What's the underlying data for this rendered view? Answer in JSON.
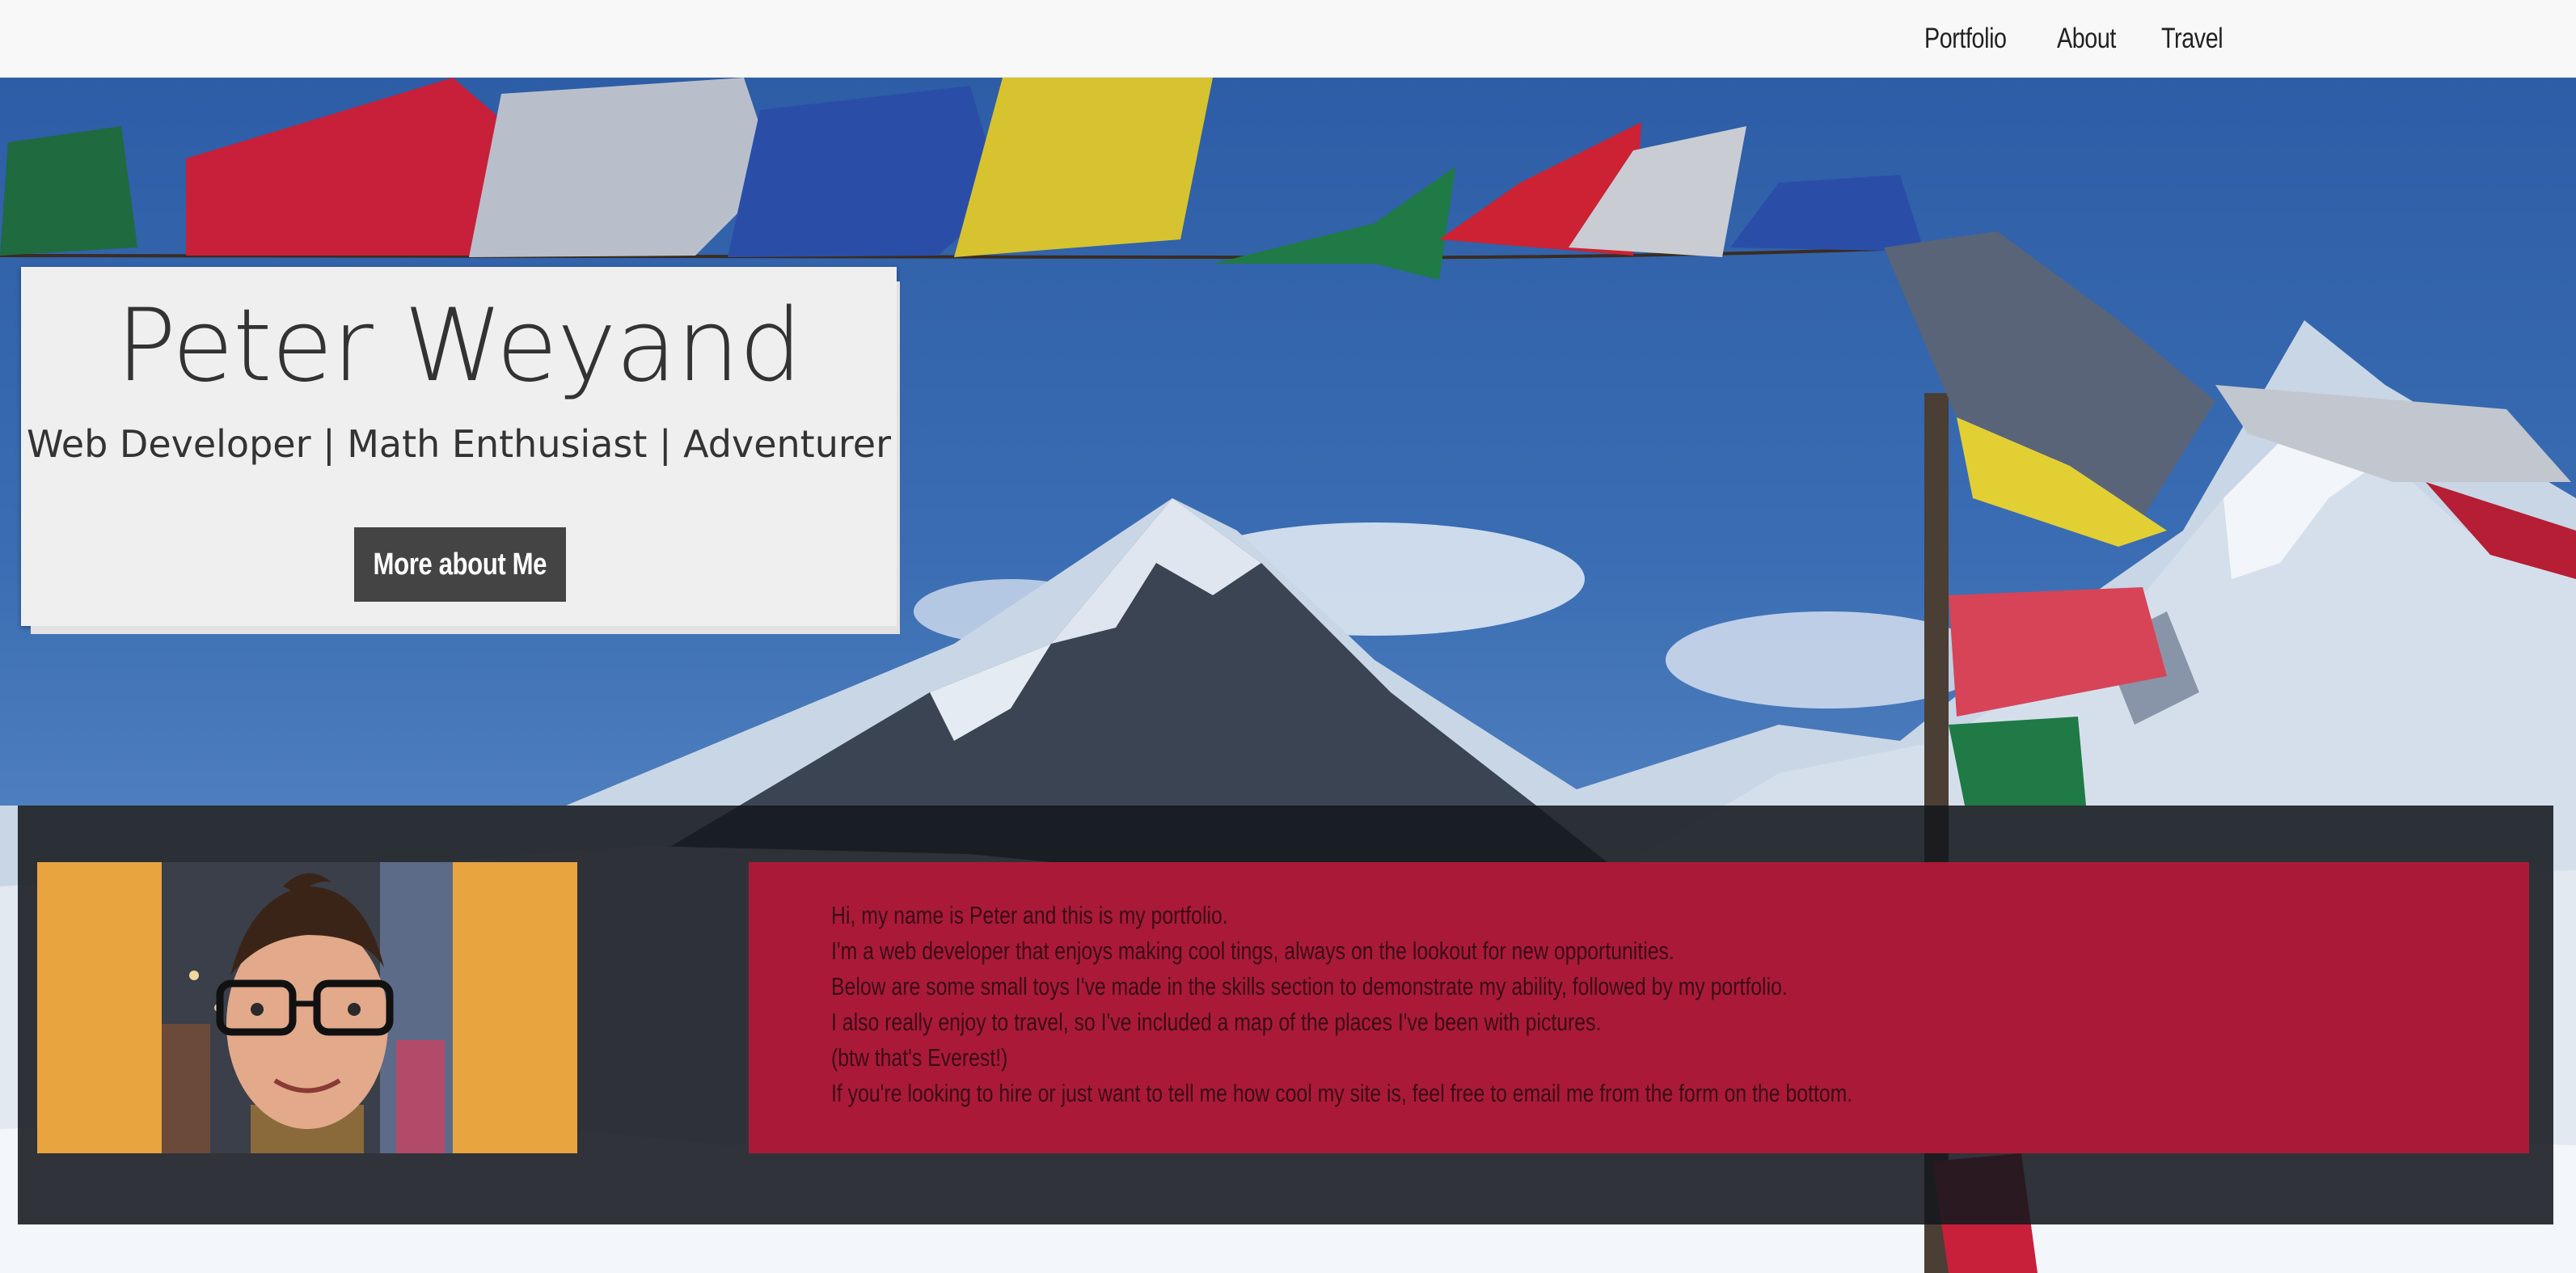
{
  "nav": {
    "items": [
      {
        "label": "Portfolio"
      },
      {
        "label": "About"
      },
      {
        "label": "Travel"
      }
    ]
  },
  "hero": {
    "name": "Peter Weyand",
    "tagline": "Web Developer | Math Enthusiast | Adventurer",
    "button_label": "More about Me"
  },
  "about": {
    "lines": [
      "Hi, my name is Peter and this is my portfolio.",
      "I'm a web developer that enjoys making cool tings, always on the lookout for new opportunities.",
      "Below are some small toys I've made in the skills section to demonstrate my ability, followed by my portfolio.",
      "I also really enjoy to travel, so I've included a map of the places I've been with pictures.",
      "(btw that's Everest!)",
      "If you're looking to hire or just want to tell me how cool my site is, feel free to email me from the form on the bottom."
    ]
  },
  "colors": {
    "navbar_bg": "#f8f8f8",
    "card_bg": "#efefef",
    "button_bg": "#444444",
    "photo_bg": "#e8a43f",
    "bio_bg": "#aa1a38"
  },
  "icons": {
    "background": "everest-prayer-flags-photo",
    "portrait": "profile-photo"
  }
}
